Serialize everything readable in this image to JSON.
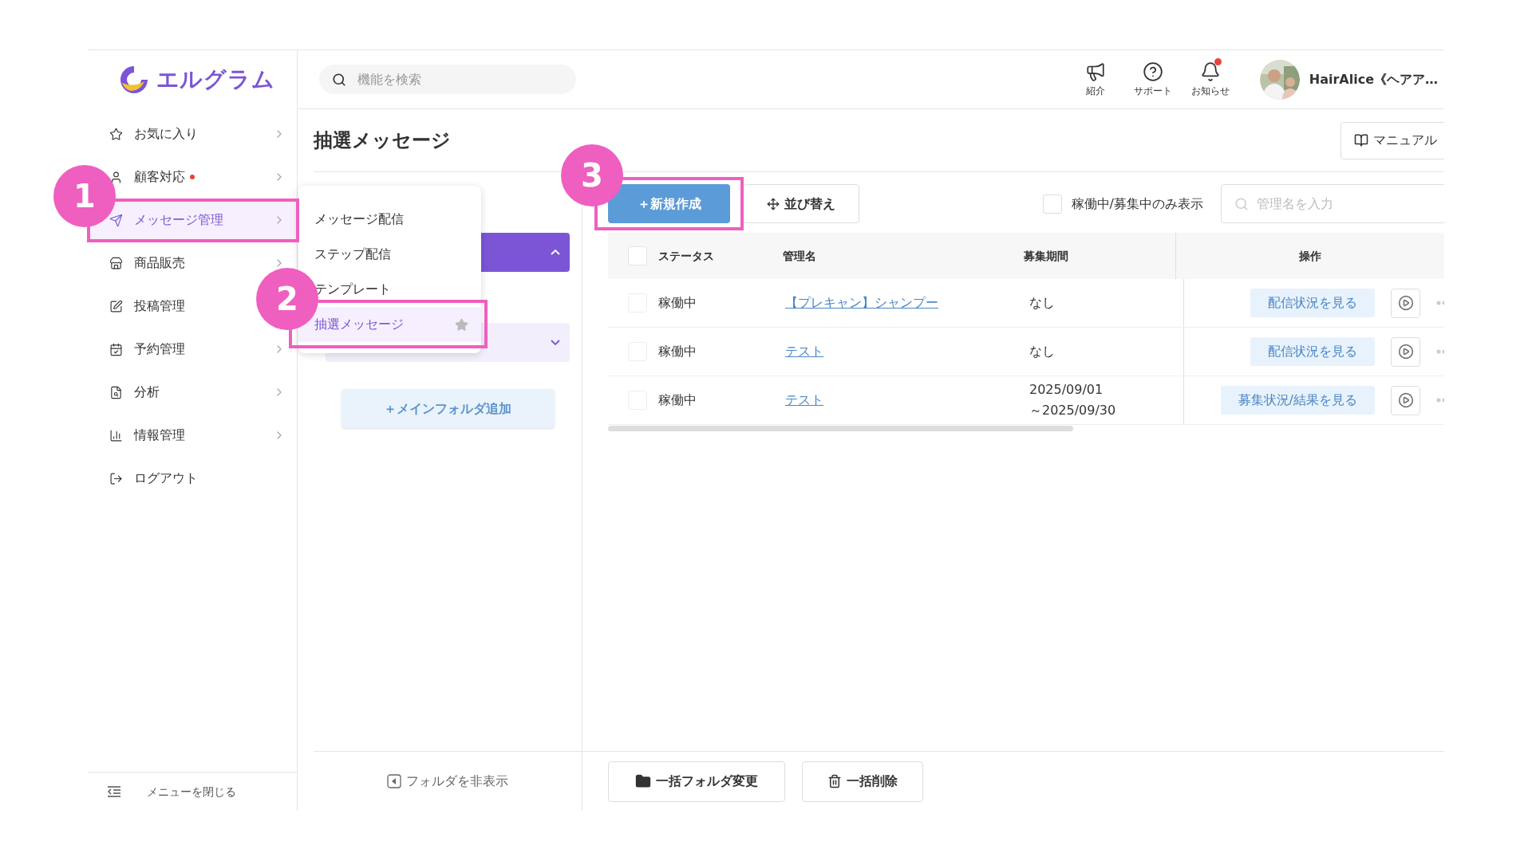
{
  "logo": {
    "text": "エルグラム"
  },
  "search": {
    "placeholder": "機能を検索"
  },
  "header_icons": [
    {
      "kind": "megaphone",
      "label": "紹介",
      "badge": false
    },
    {
      "kind": "help",
      "label": "サポート",
      "badge": false
    },
    {
      "kind": "bell",
      "label": "お知らせ",
      "badge": true
    }
  ],
  "user": {
    "name": "HairAlice《ヘアア…"
  },
  "sidebar": {
    "items": [
      {
        "label": "お気に入り",
        "selected": false,
        "badge": false
      },
      {
        "label": "顧客対応",
        "selected": false,
        "badge": true
      },
      {
        "label": "メッセージ管理",
        "selected": true,
        "badge": false
      },
      {
        "label": "商品販売",
        "selected": false,
        "badge": false
      },
      {
        "label": "投稿管理",
        "selected": false,
        "badge": false
      },
      {
        "label": "予約管理",
        "selected": false,
        "badge": false
      },
      {
        "label": "分析",
        "selected": false,
        "badge": false
      },
      {
        "label": "情報管理",
        "selected": false,
        "badge": false
      },
      {
        "label": "ログアウト",
        "selected": false,
        "badge": false
      }
    ],
    "close_label": "メニューを閉じる"
  },
  "page_title": "抽選メッセージ",
  "manual_button": "マニュアル",
  "submenu": {
    "items": [
      {
        "label": "メッセージ配信",
        "selected": false
      },
      {
        "label": "ステップ配信",
        "selected": false
      },
      {
        "label": "テンプレート",
        "selected": false
      },
      {
        "label": "抽選メッセージ",
        "selected": true
      }
    ]
  },
  "folders": {
    "groups": [
      {
        "expanded": true
      },
      {
        "expanded": false
      }
    ],
    "add_button": "＋メインフォルダ追加",
    "toggle": "フォルダを非表示"
  },
  "toolbar": {
    "new_button": "＋新規作成",
    "sort_button": "並び替え",
    "filter": {
      "label": "稼働中/募集中のみ表示",
      "checked": false
    },
    "search_placeholder": "管理名を入力"
  },
  "table": {
    "select_all": {
      "checked": false
    },
    "columns": [
      "ステータス",
      "管理名",
      "募集期間",
      "操作"
    ],
    "rows": [
      {
        "selected": false,
        "status": "稼働中",
        "name": "【プレキャン】シャンプー",
        "period": [
          "なし"
        ],
        "action": "配信状況を見る"
      },
      {
        "selected": false,
        "status": "稼働中",
        "name": "テスト",
        "period": [
          "なし"
        ],
        "action": "配信状況を見る"
      },
      {
        "selected": false,
        "status": "稼働中",
        "name": "テスト",
        "period": [
          "2025/09/01",
          "～2025/09/30"
        ],
        "action": "募集状況/結果を見る"
      }
    ]
  },
  "bulk_actions": [
    "一括フォルダ変更",
    "一括削除"
  ],
  "annotations": [
    {
      "label": "1"
    },
    {
      "label": "2"
    },
    {
      "label": "3"
    }
  ]
}
